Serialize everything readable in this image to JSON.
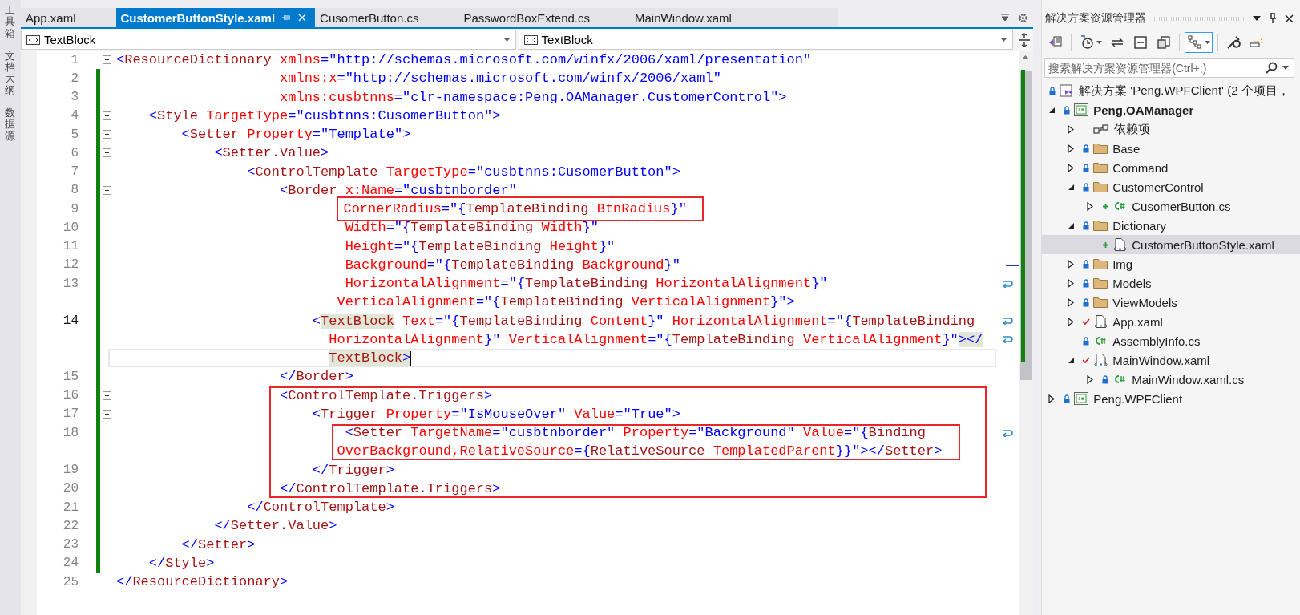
{
  "side_tabs": [
    {
      "label": "工具箱"
    },
    {
      "label": "文档大纲"
    },
    {
      "label": "数据源"
    }
  ],
  "tabs": [
    {
      "label": "App.xaml",
      "selected": false
    },
    {
      "label": "CustomerButtonStyle.xaml",
      "selected": true
    },
    {
      "label": "CusomerButton.cs",
      "selected": false
    },
    {
      "label": "PasswordBoxExtend.cs",
      "selected": false
    },
    {
      "label": "MainWindow.xaml",
      "selected": false
    }
  ],
  "navigation": [
    {
      "label": "TextBlock"
    },
    {
      "label": "TextBlock"
    }
  ],
  "editor": {
    "lines": [
      {
        "kind": "line",
        "number": "1",
        "foldable": true,
        "changed": false,
        "wrapped": false,
        "tokens": [
          {
            "kind": "value",
            "text": "<"
          },
          {
            "kind": "tag",
            "text": "ResourceDictionary"
          },
          {
            "kind": "attr",
            "text": " xmlns"
          },
          {
            "kind": "value",
            "text": "=\"http://schemas.microsoft.com/winfx/2006/xaml/presentation\""
          }
        ]
      },
      {
        "kind": "line",
        "number": "2",
        "foldable": false,
        "changed": true,
        "wrapped": false,
        "tokens": [
          {
            "kind": "attr",
            "text": "                    xmlns:x"
          },
          {
            "kind": "value",
            "text": "=\"http://schemas.microsoft.com/winfx/2006/xaml\""
          }
        ]
      },
      {
        "kind": "line",
        "number": "3",
        "foldable": false,
        "changed": true,
        "wrapped": false,
        "tokens": [
          {
            "kind": "attr",
            "text": "                    xmlns:cusbtnns"
          },
          {
            "kind": "value",
            "text": "=\"clr-namespace:Peng.OAManager.CustomerControl\">"
          }
        ]
      },
      {
        "kind": "line",
        "number": "4",
        "foldable": true,
        "changed": true,
        "wrapped": false,
        "tokens": [
          {
            "kind": "value",
            "text": "    <"
          },
          {
            "kind": "tag",
            "text": "Style"
          },
          {
            "kind": "attr",
            "text": " TargetType"
          },
          {
            "kind": "value",
            "text": "=\"cusbtnns:CusomerButton\">"
          }
        ]
      },
      {
        "kind": "line",
        "number": "5",
        "foldable": true,
        "changed": true,
        "wrapped": false,
        "tokens": [
          {
            "kind": "value",
            "text": "        <"
          },
          {
            "kind": "tag",
            "text": "Setter"
          },
          {
            "kind": "attr",
            "text": " Property"
          },
          {
            "kind": "value",
            "text": "=\"Template\">"
          }
        ]
      },
      {
        "kind": "line",
        "number": "6",
        "foldable": true,
        "changed": true,
        "wrapped": false,
        "tokens": [
          {
            "kind": "value",
            "text": "            <"
          },
          {
            "kind": "tag",
            "text": "Setter.Value"
          },
          {
            "kind": "value",
            "text": ">"
          }
        ]
      },
      {
        "kind": "line",
        "number": "7",
        "foldable": true,
        "changed": true,
        "wrapped": false,
        "tokens": [
          {
            "kind": "value",
            "text": "                <"
          },
          {
            "kind": "tag",
            "text": "ControlTemplate"
          },
          {
            "kind": "attr",
            "text": " TargetType"
          },
          {
            "kind": "value",
            "text": "=\"cusbtnns:CusomerButton\">"
          }
        ]
      },
      {
        "kind": "line",
        "number": "8",
        "foldable": true,
        "changed": true,
        "wrapped": false,
        "tokens": [
          {
            "kind": "value",
            "text": "                    <"
          },
          {
            "kind": "tag",
            "text": "Border"
          },
          {
            "kind": "attr",
            "text": " x:Name"
          },
          {
            "kind": "value",
            "text": "=\"cusbtnborder\""
          }
        ]
      },
      {
        "kind": "line",
        "number": "9",
        "foldable": false,
        "changed": true,
        "wrapped": false,
        "tokens": [
          {
            "kind": "box",
            "tokens": [
              {
                "kind": "attr",
                "text": "                           CornerRadius"
              },
              {
                "kind": "value",
                "text": "=\"{"
              },
              {
                "kind": "tag",
                "text": "TemplateBinding"
              },
              {
                "kind": "attr",
                "text": " BtnRadius"
              },
              {
                "kind": "value",
                "text": "}\""
              }
            ]
          }
        ]
      },
      {
        "kind": "line",
        "number": "10",
        "foldable": false,
        "changed": true,
        "wrapped": false,
        "tokens": [
          {
            "kind": "attr",
            "text": "                            Width"
          },
          {
            "kind": "value",
            "text": "=\"{"
          },
          {
            "kind": "tag",
            "text": "TemplateBinding"
          },
          {
            "kind": "attr",
            "text": " Width"
          },
          {
            "kind": "value",
            "text": "}\""
          }
        ]
      },
      {
        "kind": "line",
        "number": "11",
        "foldable": false,
        "changed": true,
        "wrapped": false,
        "tokens": [
          {
            "kind": "attr",
            "text": "                            Height"
          },
          {
            "kind": "value",
            "text": "=\"{"
          },
          {
            "kind": "tag",
            "text": "TemplateBinding"
          },
          {
            "kind": "attr",
            "text": " Height"
          },
          {
            "kind": "value",
            "text": "}\""
          }
        ]
      },
      {
        "kind": "line",
        "number": "12",
        "foldable": false,
        "changed": true,
        "wrapped": false,
        "tokens": [
          {
            "kind": "attr",
            "text": "                            Background"
          },
          {
            "kind": "value",
            "text": "=\"{"
          },
          {
            "kind": "tag",
            "text": "TemplateBinding"
          },
          {
            "kind": "attr",
            "text": " Background"
          },
          {
            "kind": "value",
            "text": "}\""
          }
        ]
      },
      {
        "kind": "line",
        "number": "13",
        "foldable": false,
        "changed": true,
        "wrapped": true,
        "tokens": [
          {
            "kind": "attr",
            "text": "                            HorizontalAlignment"
          },
          {
            "kind": "value",
            "text": "=\"{"
          },
          {
            "kind": "tag",
            "text": "TemplateBinding"
          },
          {
            "kind": "attr",
            "text": " HorizontalAlignment"
          },
          {
            "kind": "value",
            "text": "}\""
          }
        ]
      },
      {
        "kind": "line",
        "foldable": false,
        "changed": true,
        "wrapped": false,
        "tokens": [
          {
            "kind": "attr",
            "text": "                           VerticalAlignment"
          },
          {
            "kind": "value",
            "text": "=\"{"
          },
          {
            "kind": "tag",
            "text": "TemplateBinding"
          },
          {
            "kind": "attr",
            "text": " VerticalAlignment"
          },
          {
            "kind": "value",
            "text": "}\">"
          }
        ]
      },
      {
        "kind": "current-line",
        "number": "14",
        "foldable": false,
        "changed": true,
        "wrapped": true,
        "tokens": [
          {
            "kind": "value",
            "text": "                        <"
          },
          {
            "kind": "tag-match",
            "text": "TextBlock"
          },
          {
            "kind": "attr",
            "text": " Text"
          },
          {
            "kind": "value",
            "text": "=\"{"
          },
          {
            "kind": "tag",
            "text": "TemplateBinding"
          },
          {
            "kind": "attr",
            "text": " Content"
          },
          {
            "kind": "value",
            "text": "}\""
          },
          {
            "kind": "attr",
            "text": " HorizontalAlignment"
          },
          {
            "kind": "value",
            "text": "=\"{"
          },
          {
            "kind": "tag",
            "text": "TemplateBinding"
          }
        ]
      },
      {
        "kind": "line",
        "foldable": false,
        "changed": true,
        "wrapped": true,
        "tokens": [
          {
            "kind": "attr",
            "text": "                          HorizontalAlignment"
          },
          {
            "kind": "value",
            "text": "}\""
          },
          {
            "kind": "attr",
            "text": " VerticalAlignment"
          },
          {
            "kind": "value",
            "text": "=\"{"
          },
          {
            "kind": "tag",
            "text": "TemplateBinding"
          },
          {
            "kind": "attr",
            "text": " VerticalAlignment"
          },
          {
            "kind": "value",
            "text": "}\""
          },
          {
            "kind": "value-match",
            "text": "></"
          }
        ]
      },
      {
        "kind": "caret-line",
        "foldable": false,
        "changed": true,
        "wrapped": false,
        "tokens": [
          {
            "kind": "tag-match",
            "text": "                          TextBlock"
          },
          {
            "kind": "value-match",
            "text": ">"
          }
        ]
      },
      {
        "kind": "line",
        "number": "15",
        "foldable": false,
        "changed": true,
        "wrapped": false,
        "tokens": [
          {
            "kind": "value",
            "text": "                    </"
          },
          {
            "kind": "tag",
            "text": "Border"
          },
          {
            "kind": "value",
            "text": ">"
          }
        ]
      },
      {
        "kind": "box",
        "lines": [
          {
            "kind": "line",
            "number": "16",
            "foldable": true,
            "changed": true,
            "wrapped": false,
            "tokens": [
              {
                "kind": "value",
                "text": "                    <"
              },
              {
                "kind": "tag",
                "text": "ControlTemplate.Triggers"
              },
              {
                "kind": "value",
                "text": ">"
              }
            ]
          },
          {
            "kind": "line",
            "number": "17",
            "foldable": true,
            "changed": true,
            "wrapped": false,
            "tokens": [
              {
                "kind": "value",
                "text": "                        <"
              },
              {
                "kind": "tag",
                "text": "Trigger"
              },
              {
                "kind": "attr",
                "text": " Property"
              },
              {
                "kind": "value",
                "text": "=\"IsMouseOver\""
              },
              {
                "kind": "attr",
                "text": " Value"
              },
              {
                "kind": "value",
                "text": "=\"True\">"
              }
            ]
          },
          {
            "kind": "box",
            "lines": [
              {
                "kind": "line",
                "number": "18",
                "foldable": false,
                "changed": true,
                "wrapped": true,
                "tokens": [
                  {
                    "kind": "value",
                    "text": "                            <"
                  },
                  {
                    "kind": "tag",
                    "text": "Setter"
                  },
                  {
                    "kind": "attr",
                    "text": " TargetName"
                  },
                  {
                    "kind": "value",
                    "text": "=\"cusbtnborder\""
                  },
                  {
                    "kind": "attr",
                    "text": " Property"
                  },
                  {
                    "kind": "value",
                    "text": "=\"Background\""
                  },
                  {
                    "kind": "attr",
                    "text": " Value"
                  },
                  {
                    "kind": "value",
                    "text": "=\"{"
                  },
                  {
                    "kind": "tag",
                    "text": "Binding"
                  }
                ]
              },
              {
                "kind": "line",
                "foldable": false,
                "changed": true,
                "wrapped": false,
                "tokens": [
                  {
                    "kind": "attr",
                    "text": "                           OverBackground,RelativeSource"
                  },
                  {
                    "kind": "value",
                    "text": "={"
                  },
                  {
                    "kind": "tag",
                    "text": "RelativeSource"
                  },
                  {
                    "kind": "attr",
                    "text": " TemplatedParent"
                  },
                  {
                    "kind": "value",
                    "text": "}}\"></"
                  },
                  {
                    "kind": "tag",
                    "text": "Setter"
                  },
                  {
                    "kind": "value",
                    "text": ">"
                  }
                ]
              }
            ]
          },
          {
            "kind": "line",
            "number": "19",
            "foldable": false,
            "changed": true,
            "wrapped": false,
            "tokens": [
              {
                "kind": "value",
                "text": "                        </"
              },
              {
                "kind": "tag",
                "text": "Trigger"
              },
              {
                "kind": "value",
                "text": ">"
              }
            ]
          },
          {
            "kind": "line",
            "number": "20",
            "foldable": false,
            "changed": true,
            "wrapped": false,
            "tokens": [
              {
                "kind": "value",
                "text": "                    </"
              },
              {
                "kind": "tag",
                "text": "ControlTemplate.Triggers"
              },
              {
                "kind": "value",
                "text": ">"
              }
            ]
          }
        ]
      },
      {
        "kind": "line",
        "number": "21",
        "foldable": false,
        "changed": true,
        "wrapped": false,
        "tokens": [
          {
            "kind": "value",
            "text": "                </"
          },
          {
            "kind": "tag",
            "text": "ControlTemplate"
          },
          {
            "kind": "value",
            "text": ">"
          }
        ]
      },
      {
        "kind": "line",
        "number": "22",
        "foldable": false,
        "changed": true,
        "wrapped": false,
        "tokens": [
          {
            "kind": "value",
            "text": "            </"
          },
          {
            "kind": "tag",
            "text": "Setter.Value"
          },
          {
            "kind": "value",
            "text": ">"
          }
        ]
      },
      {
        "kind": "line",
        "number": "23",
        "foldable": false,
        "changed": true,
        "wrapped": false,
        "tokens": [
          {
            "kind": "value",
            "text": "        </"
          },
          {
            "kind": "tag",
            "text": "Setter"
          },
          {
            "kind": "value",
            "text": ">"
          }
        ]
      },
      {
        "kind": "line",
        "number": "24",
        "foldable": false,
        "changed": true,
        "wrapped": false,
        "tokens": [
          {
            "kind": "value",
            "text": "    </"
          },
          {
            "kind": "tag",
            "text": "Style"
          },
          {
            "kind": "value",
            "text": ">"
          }
        ]
      },
      {
        "kind": "line",
        "number": "25",
        "foldable": false,
        "changed": false,
        "wrapped": false,
        "tokens": [
          {
            "kind": "value",
            "text": "</"
          },
          {
            "kind": "tag",
            "text": "ResourceDictionary"
          },
          {
            "kind": "value",
            "text": ">"
          }
        ]
      }
    ]
  },
  "solution_explorer": {
    "title": "解决方案资源管理器",
    "toolbar": [
      {
        "kind": "switch-views",
        "dropdown": false,
        "selected": false
      },
      {
        "kind": "separator"
      },
      {
        "kind": "history",
        "dropdown": true,
        "selected": false
      },
      {
        "kind": "sync",
        "dropdown": false,
        "selected": false
      },
      {
        "kind": "collapse",
        "dropdown": false,
        "selected": false
      },
      {
        "kind": "copies",
        "dropdown": false,
        "selected": false
      },
      {
        "kind": "separator"
      },
      {
        "kind": "tree-view",
        "dropdown": true,
        "selected": true
      },
      {
        "kind": "separator"
      },
      {
        "kind": "properties",
        "dropdown": false,
        "selected": false
      },
      {
        "kind": "preview",
        "dropdown": false,
        "selected": false
      }
    ],
    "search": {
      "placeholder": "搜索解决方案资源管理器(Ctrl+;)"
    },
    "tree": [
      {
        "label": "解决方案 'Peng.WPFClient' (2 个项目，",
        "kind": "solution",
        "status": {
          "kind": "lock"
        },
        "selected": false,
        "children": [
          {
            "label": "Peng.OAManager",
            "kind": "project",
            "status": {
              "kind": "lock"
            },
            "startup": true,
            "expanded": true,
            "selected": false,
            "children": [
              {
                "label": "依赖项",
                "kind": "dependencies",
                "expanded": false,
                "selected": false
              },
              {
                "label": "Base",
                "kind": "folder",
                "status": {
                  "kind": "lock"
                },
                "expanded": false,
                "selected": false
              },
              {
                "label": "Command",
                "kind": "folder",
                "status": {
                  "kind": "lock"
                },
                "expanded": false,
                "selected": false
              },
              {
                "label": "CustomerControl",
                "kind": "folder",
                "status": {
                  "kind": "lock"
                },
                "expanded": true,
                "selected": false,
                "children": [
                  {
                    "label": "CusomerButton.cs",
                    "kind": "csharp",
                    "status": {
                      "kind": "add"
                    },
                    "expanded": false,
                    "selected": false
                  }
                ]
              },
              {
                "label": "Dictionary",
                "kind": "folder",
                "status": {
                  "kind": "lock"
                },
                "expanded": true,
                "selected": false,
                "children": [
                  {
                    "label": "CustomerButtonStyle.xaml",
                    "kind": "xaml",
                    "status": {
                      "kind": "add"
                    },
                    "selected": true
                  }
                ]
              },
              {
                "label": "Img",
                "kind": "folder",
                "status": {
                  "kind": "lock"
                },
                "expanded": false,
                "selected": false
              },
              {
                "label": "Models",
                "kind": "folder",
                "status": {
                  "kind": "lock"
                },
                "expanded": false,
                "selected": false
              },
              {
                "label": "ViewModels",
                "kind": "folder",
                "status": {
                  "kind": "lock"
                },
                "expanded": false,
                "selected": false
              },
              {
                "label": "App.xaml",
                "kind": "xaml",
                "status": {
                  "kind": "check"
                },
                "expanded": false,
                "selected": false
              },
              {
                "label": "AssemblyInfo.cs",
                "kind": "csharp",
                "status": {
                  "kind": "lock"
                },
                "selected": false
              },
              {
                "label": "MainWindow.xaml",
                "kind": "xaml",
                "status": {
                  "kind": "check"
                },
                "expanded": true,
                "selected": false,
                "children": [
                  {
                    "label": "MainWindow.xaml.cs",
                    "kind": "csharp",
                    "status": {
                      "kind": "lock"
                    },
                    "expanded": false,
                    "selected": false
                  }
                ]
              }
            ]
          },
          {
            "label": "Peng.WPFClient",
            "kind": "project",
            "status": {
              "kind": "lock"
            },
            "startup": false,
            "expanded": false,
            "selected": false
          }
        ]
      }
    ]
  }
}
